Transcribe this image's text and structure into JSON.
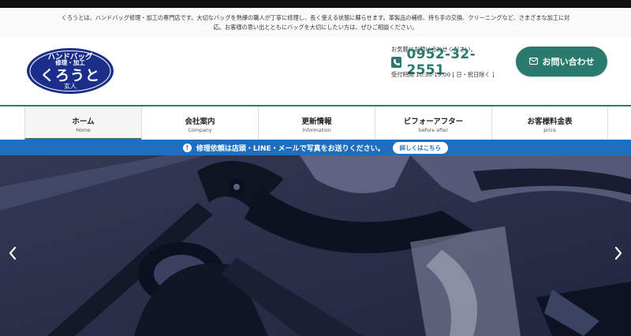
{
  "intro": {
    "line1": "くろうとは、ハンドバッグ修理・加工の専門店です。大切なバッグを熟練の職人が丁寧に修理し、長く使える状態に蘇らせます。革製品の補修、持ち手の交換、クリーニングなど、さまざまな加工に対",
    "line2": "応。お客様の思い出とともにバッグを大切にしたい方は、ぜひご相談ください。"
  },
  "logo": {
    "line1": "ハンドバッグ",
    "line2": "修理・加工",
    "line3": "くろうと",
    "line4": "玄人",
    "color": "#1b2f8a"
  },
  "contact": {
    "note": "お気軽にお問い合わせください。",
    "phone_icon": "phone-icon",
    "phone": "0952-32-2551",
    "hours": "受付時間 10:30-19:00 [ 日・祝日除く ]",
    "button_label": "お問い合わせ",
    "button_icon": "mail-icon",
    "accent": "#2a7a6e"
  },
  "nav": {
    "items": [
      {
        "ja": "ホーム",
        "en": "Home"
      },
      {
        "ja": "会社案内",
        "en": "Company"
      },
      {
        "ja": "更新情報",
        "en": "Information"
      },
      {
        "ja": "ビフォーアフター",
        "en": "before after"
      },
      {
        "ja": "お客様料金表",
        "en": "price"
      }
    ],
    "active_index": 0
  },
  "notice": {
    "icon": "info-icon",
    "text": "修理依頼は店頭・LINE・メールで写真をお送りください。",
    "button": "詳しくはこちら",
    "color": "#1e6fc0"
  },
  "slider": {
    "prev_icon": "chevron-left-icon",
    "next_icon": "chevron-right-icon"
  }
}
